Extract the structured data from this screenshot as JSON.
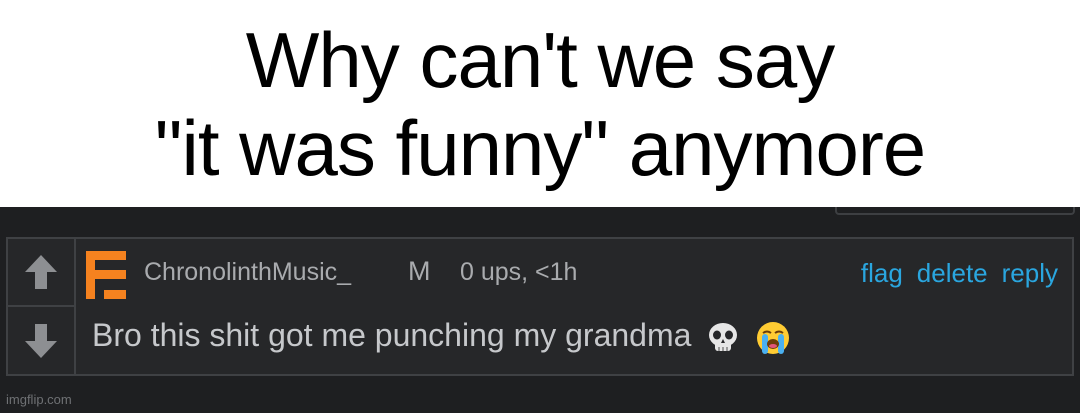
{
  "caption": {
    "line1": "Why can't we say",
    "line2": "\"it was funny\" anymore"
  },
  "comment": {
    "username": "ChronolinthMusic_",
    "badge": "M",
    "meta": "0 ups, <1h",
    "actions": {
      "flag": "flag",
      "delete": "delete",
      "reply": "reply"
    },
    "text": "Bro this shit got me punching my grandma",
    "emojis": [
      "skull-emoji",
      "loudly-crying-emoji"
    ]
  },
  "watermark": "imgflip.com",
  "colors": {
    "background_dark": "#1e1f21",
    "comment_bg": "#262729",
    "action_link": "#2aa6df",
    "logo_orange": "#f5821f",
    "muted_text": "#a9abae"
  },
  "icons": {
    "upvote": "up-arrow-icon",
    "downvote": "down-arrow-icon",
    "avatar": "imgflip-logo-icon"
  }
}
